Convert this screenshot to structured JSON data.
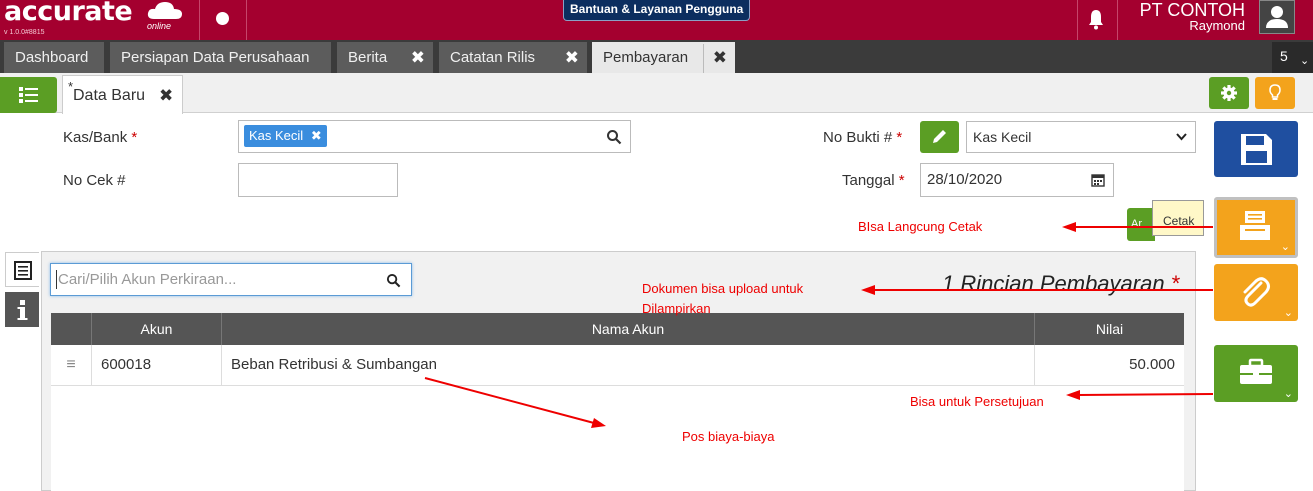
{
  "app": {
    "logo": "accurate",
    "logo_sub": "online",
    "version": "v 1.0.0#8815",
    "help_button": "Bantuan & Layanan Pengguna",
    "company_name": "PT CONTOH",
    "user_name": "Raymond",
    "brand_color": "#a4002f"
  },
  "tabs": [
    {
      "label": "Dashboard",
      "closable": false
    },
    {
      "label": "Persiapan Data Perusahaan",
      "closable": false
    },
    {
      "label": "Berita",
      "closable": true
    },
    {
      "label": "Catatan Rilis",
      "closable": true
    },
    {
      "label": "Pembayaran",
      "closable": true,
      "active": true
    }
  ],
  "tab_count": "5",
  "doc_tab": {
    "marker": "*",
    "label": "Data Baru"
  },
  "form": {
    "kas_bank_label": "Kas/Bank",
    "kas_bank_value": "Kas Kecil",
    "no_cek_label": "No Cek #",
    "no_cek_value": "",
    "no_bukti_label": "No Bukti #",
    "no_bukti_value": "Kas Kecil",
    "tanggal_label": "Tanggal",
    "tanggal_value": "28/10/2020",
    "required_mark": "*"
  },
  "actions": {
    "print_tooltip": "Cetak",
    "peek_label": "Ar"
  },
  "detail": {
    "search_placeholder": "Cari/Pilih Akun Perkiraan...",
    "title": "1 Rincian Pembayaran",
    "required_mark": "*",
    "columns": [
      "Akun",
      "Nama Akun",
      "Nilai"
    ],
    "rows": [
      {
        "akun": "600018",
        "nama_akun": "Beban Retribusi & Sumbangan",
        "nilai": "50.000"
      }
    ]
  },
  "annotations": {
    "print": "BIsa Langcung Cetak",
    "upload_line1": "Dokumen bisa upload untuk",
    "upload_line2": "Dilampirkan",
    "approval": "Bisa untuk Persetujuan",
    "costs": "Pos biaya-biaya",
    "color": "#e00000"
  }
}
